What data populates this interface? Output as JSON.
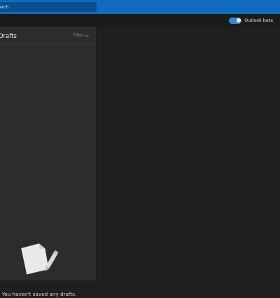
{
  "header": {
    "search_text": "arch"
  },
  "subbar": {
    "toggle_label": "Outlook beta",
    "toggle_on": true
  },
  "list": {
    "folder_title": "Drafts",
    "filter_label": "Filter",
    "empty_message": "You haven't saved any drafts."
  },
  "colors": {
    "brand_blue": "#0f6cbd",
    "accent_link": "#4ea2e6",
    "pane_bg": "#2c2c2c",
    "app_bg": "#1f1f1f"
  },
  "icons": {
    "filter_chevron": "chevron-down-icon",
    "empty_state": "draft-pencil-illustration"
  }
}
